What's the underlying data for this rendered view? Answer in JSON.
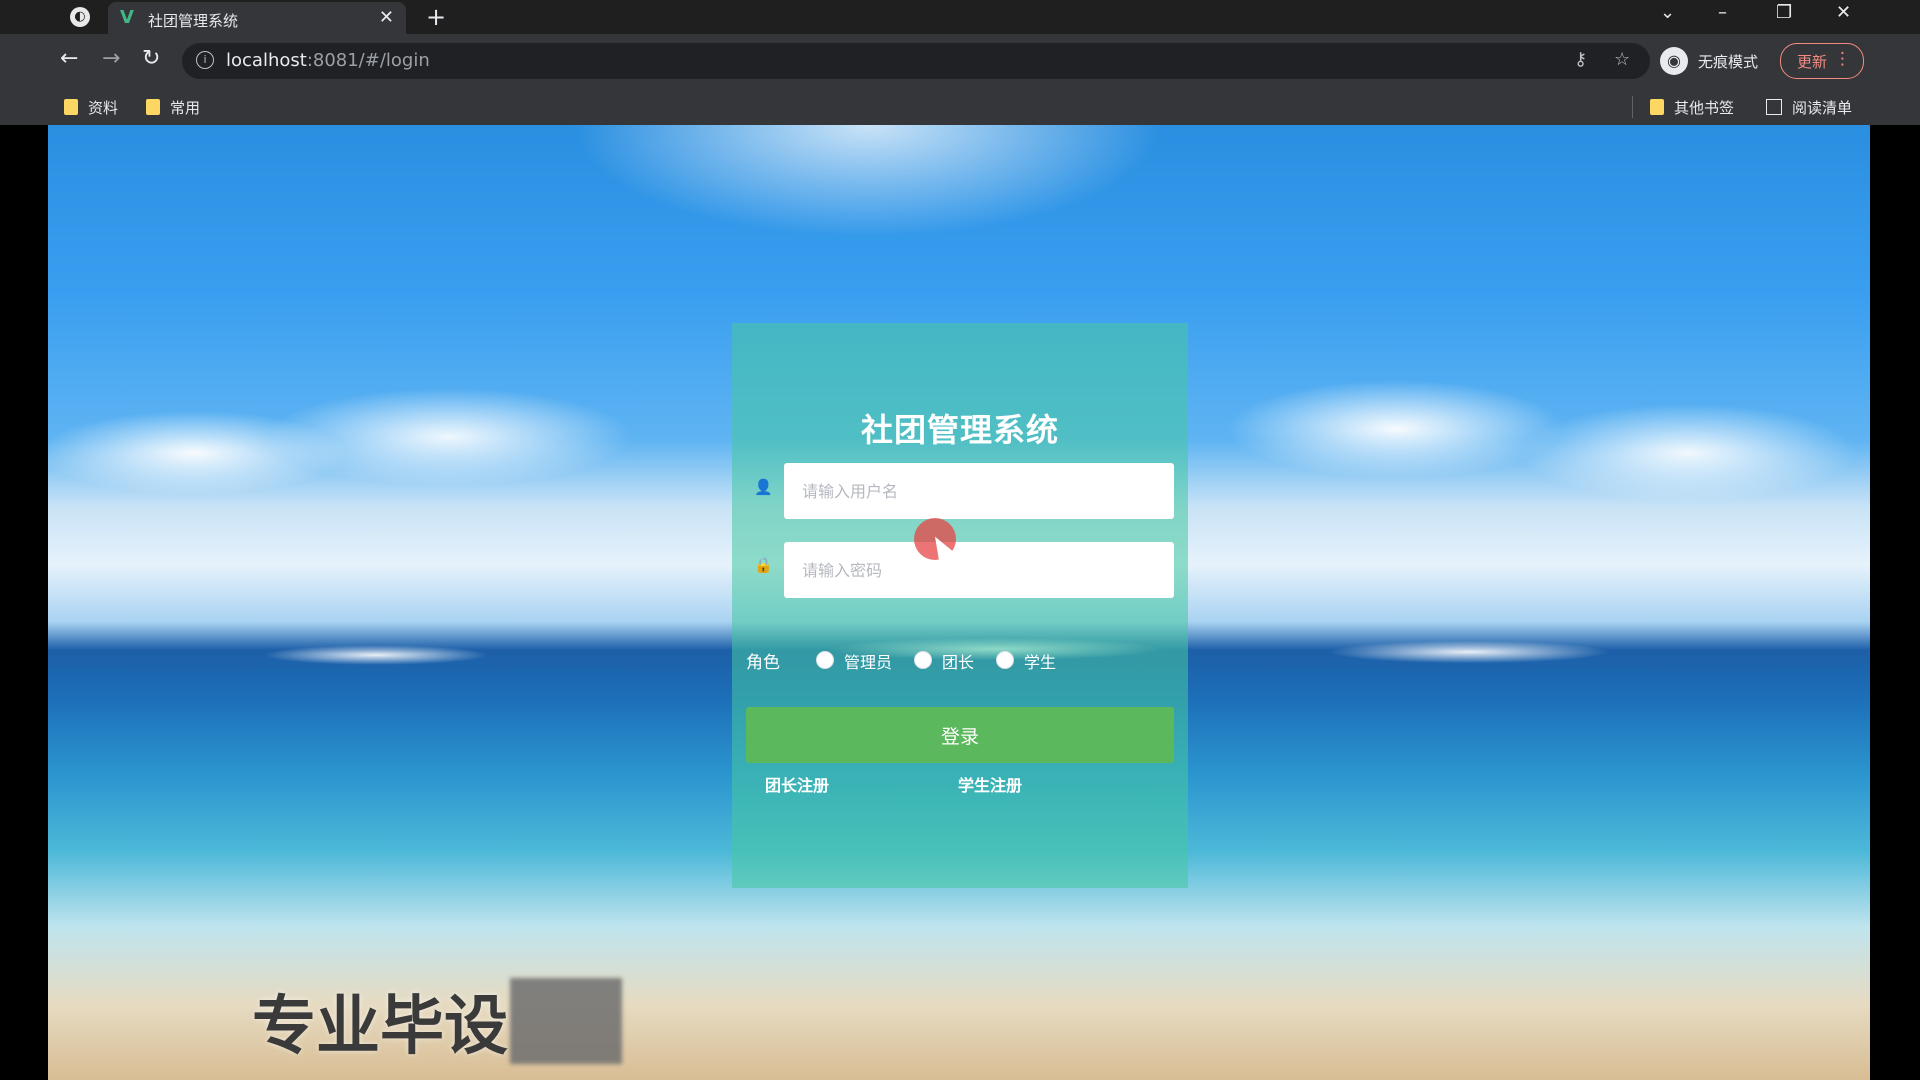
{
  "browser": {
    "tab_title": "社团管理系统",
    "tab_favicon": "V",
    "new_tab": "+",
    "url_host": "localhost",
    "url_rest": ":8081/#/login",
    "profile_label": "无痕模式",
    "update_label": "更新",
    "bookmarks": [
      "资料",
      "常用"
    ],
    "other_bookmarks": "其他书签",
    "reading_list": "阅读清单",
    "icons": [
      "browser-logo-icon",
      "close-icon",
      "back-icon",
      "forward-icon",
      "reload-icon",
      "info-icon",
      "key-icon",
      "star-icon",
      "more-icon",
      "folder-icon",
      "reading-list-icon",
      "minimize-icon",
      "maximize-icon",
      "chevron-down-icon"
    ]
  },
  "login": {
    "title": "社团管理系统",
    "username_placeholder": "请输入用户名",
    "password_placeholder": "请输入密码",
    "role_label": "角色",
    "roles": [
      "管理员",
      "团长",
      "学生"
    ],
    "login_button": "登录",
    "register_leader": "团长注册",
    "register_student": "学生注册",
    "panel_color": "#46c8a0",
    "button_color": "#5cb85c"
  },
  "overlay": {
    "watermark_text": "专业毕设"
  }
}
